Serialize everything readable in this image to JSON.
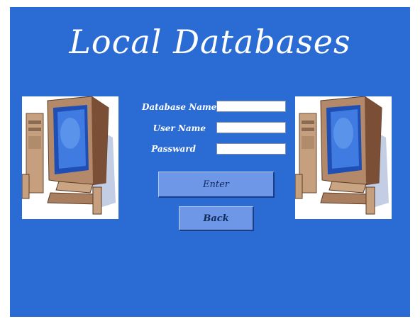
{
  "window": {
    "title": "Local Databases"
  },
  "form": {
    "database_name_label": "Database Name",
    "user_name_label": "User Name",
    "password_label": "Passward",
    "database_name_value": "",
    "user_name_value": "",
    "password_value": ""
  },
  "buttons": {
    "enter_label": "Enter",
    "back_label": "Back"
  },
  "colors": {
    "background": "#2b6cd4",
    "button": "#6f97e8",
    "text": "#ffffff"
  },
  "icons": {
    "left_image": "computer-icon",
    "right_image": "computer-icon"
  }
}
